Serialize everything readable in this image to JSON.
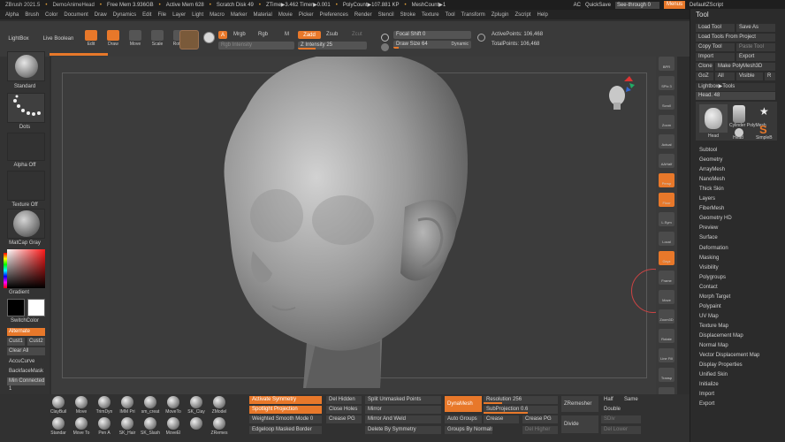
{
  "titlebar": {
    "app": "ZBrush 2021.5",
    "doc": "DemoAnimeHead",
    "free_mem": "Free Mem 3.936GB",
    "active_mem": "Active Mem 628",
    "scratch": "Scratch Disk 49",
    "ztime": "ZTime▶3.462 Timer▶0.001",
    "poly": "PolyCount▶107.881 KP",
    "mesh": "MeshCount▶1",
    "ac": "AC",
    "quicksave": "QuickSave",
    "seethrough": "See-through 0",
    "menus": "Menus",
    "zscript": "DefaultZScript"
  },
  "menus": [
    "Alpha",
    "Brush",
    "Color",
    "Document",
    "Draw",
    "Dynamics",
    "Edit",
    "File",
    "Layer",
    "Light",
    "Macro",
    "Marker",
    "Material",
    "Movie",
    "Picker",
    "Preferences",
    "Render",
    "Stencil",
    "Stroke",
    "Texture",
    "Tool",
    "Transform",
    "Zplugin",
    "Zscript",
    "Help"
  ],
  "topshelf": {
    "lightbox": "LightBox",
    "live_boolean": "Live Boolean",
    "tools": [
      "Edit",
      "Draw",
      "Move",
      "Scale",
      "Rotate"
    ],
    "a_label": "A",
    "mrgb": "Mrgb",
    "rgb": "Rgb",
    "m": "M",
    "rgb_intensity": "Rgb Intensity",
    "zadd": "Zadd",
    "zsub": "Zsub",
    "zcut": "Zcut",
    "z_intensity": "Z Intensity 25",
    "focal_shift": "Focal Shift 0",
    "draw_size": "Draw Size 64",
    "dynamic": "Dynamic",
    "active_points": "ActivePoints: 106,468",
    "total_points": "TotalPoints: 106,468",
    "z_intensity_value": 25,
    "draw_size_value": 64
  },
  "leftshelf": {
    "standard": "Standard",
    "dots": "Dots",
    "alpha_off": "Alpha Off",
    "texture_off": "Texture Off",
    "matcap": "MatCap Gray",
    "gradient": "Gradient",
    "switchcolor": "SwitchColor",
    "alternate": "Alternate",
    "cust1": "Cust1",
    "cust2": "Cust2",
    "clear_all": "Clear All",
    "accucurve": "AccuCurve",
    "backfacemask": "BackfaceMask",
    "min_connected": "Min Connected 1"
  },
  "dock": [
    {
      "label": "BPR",
      "icon": "render-icon"
    },
    {
      "label": "SPix 3",
      "icon": "spix-icon"
    },
    {
      "label": "Scroll",
      "icon": "hand-icon"
    },
    {
      "label": "Zoom",
      "icon": "zoom-icon"
    },
    {
      "label": "Actual",
      "icon": "actual-icon"
    },
    {
      "label": "AAHalf",
      "icon": "aahalf-icon"
    },
    {
      "label": "Persp",
      "icon": "persp-icon"
    },
    {
      "label": "Floor",
      "icon": "floor-icon"
    },
    {
      "label": "L.Sym",
      "icon": "sym-icon"
    },
    {
      "label": "Local",
      "icon": "local-icon"
    },
    {
      "label": "Gxyz",
      "icon": "axis-icon"
    },
    {
      "label": "Frame",
      "icon": "frame-icon"
    },
    {
      "label": "Move",
      "icon": "move-icon"
    },
    {
      "label": "Zoom3D",
      "icon": "zoom3d-icon"
    },
    {
      "label": "Rotate",
      "icon": "rotate-icon"
    },
    {
      "label": "Line Fill PolyF",
      "icon": "polyframe-icon"
    },
    {
      "label": "Transp",
      "icon": "transp-icon"
    },
    {
      "label": "Solo",
      "icon": "solo-icon"
    },
    {
      "label": "Xpose",
      "icon": "xpose-icon"
    }
  ],
  "toolpanel": {
    "title": "Tool",
    "load_tool": "Load Tool",
    "save_as": "Save As",
    "load_tools_from_project": "Load Tools From Project",
    "copy_tool": "Copy Tool",
    "paste_tool": "Paste Tool",
    "import": "Import",
    "export": "Export",
    "clone": "Clone",
    "make_polymesh": "Make PolyMesh3D",
    "goz": "GoZ",
    "all": "All",
    "visible": "Visible",
    "r": "R",
    "lightbox_tools": "Lightbox▶Tools",
    "head": "Head. 48",
    "thumbs": [
      "Head",
      "Cylinder PolyMesh",
      "Head",
      "SimpleB"
    ],
    "items": [
      "Subtool",
      "Geometry",
      "ArrayMesh",
      "NanoMesh",
      "Thick Skin",
      "Layers",
      "FiberMesh",
      "Geometry HD",
      "Preview",
      "Surface",
      "Deformation",
      "Masking",
      "Visibility",
      "Polygroups",
      "Contact",
      "Morph Target",
      "Polypaint",
      "UV Map",
      "Texture Map",
      "Displacement Map",
      "Normal Map",
      "Vector Displacement Map",
      "Display Properties",
      "Unified Skin",
      "Initialize",
      "Import",
      "Export"
    ]
  },
  "bottom": {
    "brushes_row1": [
      "ClayBuil",
      "Move",
      "TrimDyn",
      "IMM Pri",
      "sm_creat",
      "MoveTo",
      "SK_Clay",
      "ZModel"
    ],
    "brushes_row2": [
      "Standar",
      "Move To",
      "Pen A",
      "SK_Hair",
      "SK_Slash",
      "MoveEl",
      "",
      "ZRemes"
    ],
    "activate_symmetry": "Activate Symmetry",
    "spotlight_projection": "Spotlight Projection",
    "weighted_smooth": "Weighted Smooth Mode 0",
    "edgeloop_masked": "Edgeloop Masked Border",
    "del_hidden": "Del Hidden",
    "close_holes": "Close Holes",
    "crease_pg": "Crease PG",
    "split_unmasked": "Split Unmasked Points",
    "mirror": "Mirror",
    "mirror_weld": "Mirror And Weld",
    "delete_by_symmetry": "Delete By Symmetry",
    "dynamesh": "DynaMesh",
    "auto_groups": "Auto Groups",
    "groups_by_normals": "Groups By Normals",
    "resolution": "Resolution 256",
    "subprojection": "SubProjection 0.6",
    "crease": "Crease",
    "crease_pg2": "Crease PG",
    "del_higher": "Del Higher",
    "zremesher": "ZRemesher",
    "divide": "Divide",
    "half": "Half",
    "same": "Same",
    "double": "Double",
    "sdiv": "SDiv",
    "del_lower": "Del Lower",
    "resolution_value": 256,
    "subprojection_value": 0.6
  },
  "colors": {
    "accent": "#e8782a",
    "bg": "#2e2e2e",
    "viewport": "#3c3c3c"
  }
}
